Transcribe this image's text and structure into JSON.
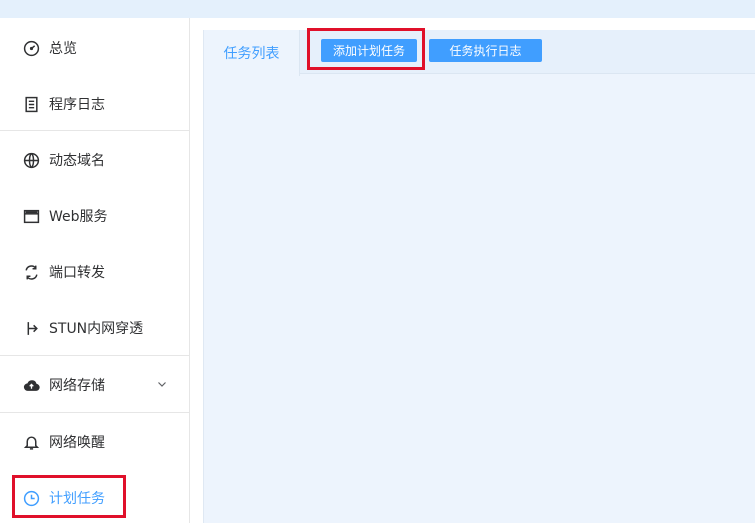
{
  "sidebar": {
    "items": [
      {
        "label": "总览",
        "icon": "dashboard-icon"
      },
      {
        "label": "程序日志",
        "icon": "log-icon"
      },
      {
        "label": "动态域名",
        "icon": "dns-icon"
      },
      {
        "label": "Web服务",
        "icon": "web-service-icon"
      },
      {
        "label": "端口转发",
        "icon": "port-forward-icon"
      },
      {
        "label": "STUN内网穿透",
        "icon": "stun-icon"
      },
      {
        "label": "网络存储",
        "icon": "cloud-storage-icon"
      },
      {
        "label": "网络唤醒",
        "icon": "bell-icon"
      },
      {
        "label": "计划任务",
        "icon": "clock-icon"
      }
    ]
  },
  "tabs": {
    "task_list": "任务列表",
    "add_task": "添加计划任务",
    "task_log": "任务执行日志"
  },
  "colors": {
    "accent": "#409eff",
    "highlight": "#e0102a"
  }
}
